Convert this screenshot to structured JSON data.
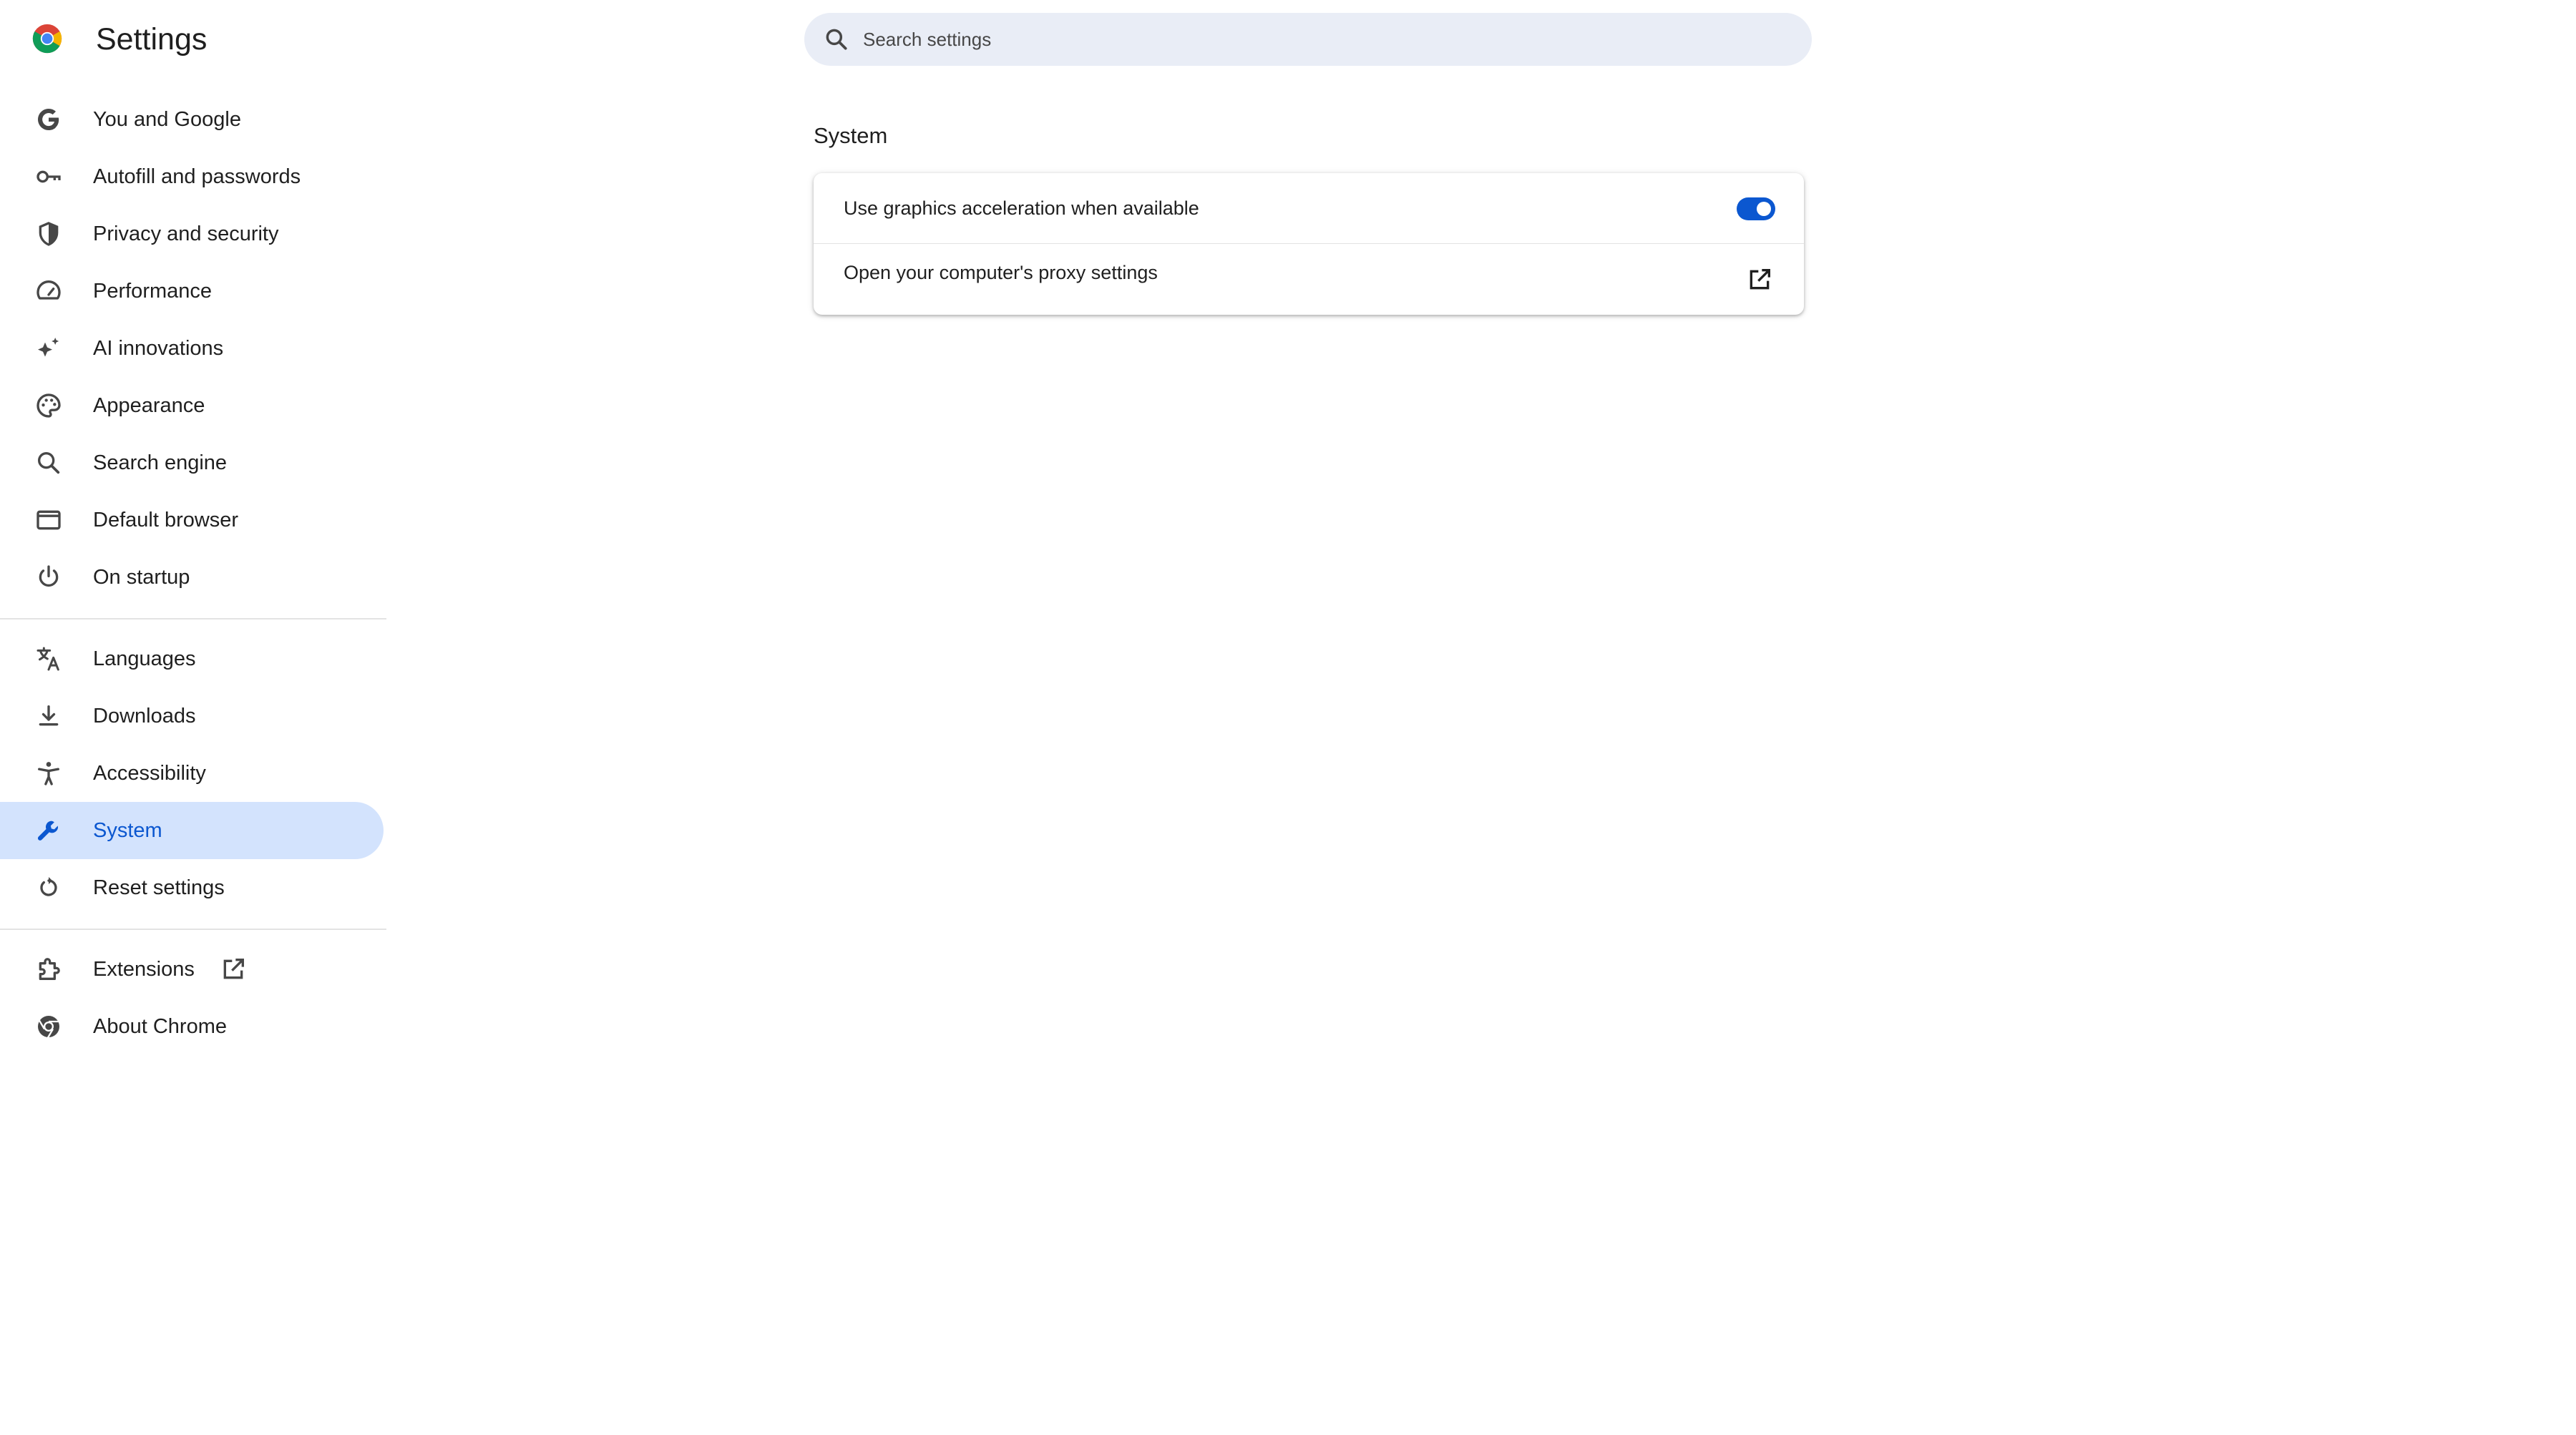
{
  "header": {
    "title": "Settings",
    "search_placeholder": "Search settings"
  },
  "sidebar": {
    "groups": [
      [
        {
          "label": "You and Google",
          "icon": "google-g-icon"
        },
        {
          "label": "Autofill and passwords",
          "icon": "key-icon"
        },
        {
          "label": "Privacy and security",
          "icon": "shield-icon"
        },
        {
          "label": "Performance",
          "icon": "speedometer-icon"
        },
        {
          "label": "AI innovations",
          "icon": "sparkle-icon"
        },
        {
          "label": "Appearance",
          "icon": "palette-icon"
        },
        {
          "label": "Search engine",
          "icon": "search-icon"
        },
        {
          "label": "Default browser",
          "icon": "browser-window-icon"
        },
        {
          "label": "On startup",
          "icon": "power-icon"
        }
      ],
      [
        {
          "label": "Languages",
          "icon": "translate-icon"
        },
        {
          "label": "Downloads",
          "icon": "download-icon"
        },
        {
          "label": "Accessibility",
          "icon": "accessibility-icon"
        },
        {
          "label": "System",
          "icon": "wrench-icon",
          "selected": true
        },
        {
          "label": "Reset settings",
          "icon": "reset-icon"
        }
      ],
      [
        {
          "label": "Extensions",
          "icon": "puzzle-icon",
          "external": true
        },
        {
          "label": "About Chrome",
          "icon": "chrome-icon"
        }
      ]
    ]
  },
  "main": {
    "section_title": "System",
    "rows": [
      {
        "label": "Use graphics acceleration when available",
        "control": "toggle",
        "checked": true
      },
      {
        "label": "Open your computer's proxy settings",
        "control": "external-link"
      }
    ]
  },
  "colors": {
    "accent": "#0b57d0",
    "selected_bg": "#d3e3fd",
    "search_bg": "#e9edf6",
    "icon": "#474747",
    "divider": "#e3e3e3"
  }
}
